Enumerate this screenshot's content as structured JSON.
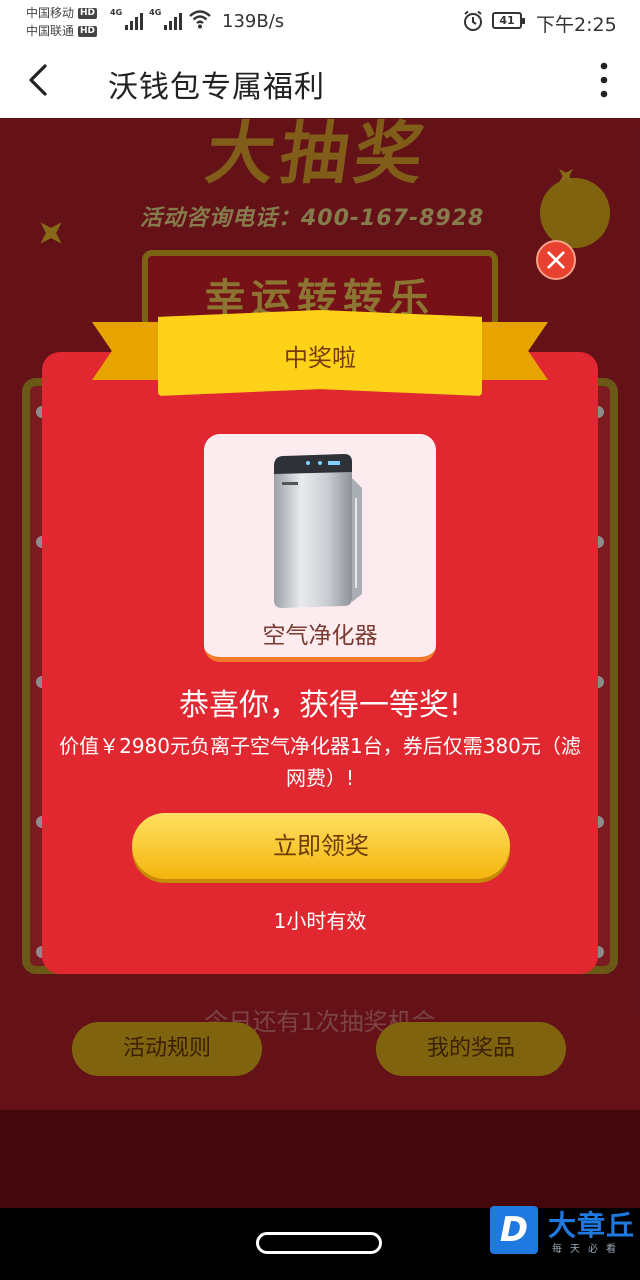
{
  "status_bar": {
    "carrier1": "中国移动",
    "carrier2": "中国联通",
    "hd": "HD",
    "network_type": "4G",
    "net_speed": "139B/s",
    "battery": "41",
    "time": "下午2:25"
  },
  "title_bar": {
    "title": "沃钱包专属福利",
    "back_icon": "chevron-left-icon",
    "more_icon": "more-vertical-icon"
  },
  "background": {
    "big_title": "大抽奖",
    "phone_line": "活动咨询电话：400-167-8928",
    "lucky_title": "幸运转转乐",
    "chances": "今日还有1次抽奖机会",
    "rules_button": "活动规则",
    "prizes_button": "我的奖品"
  },
  "modal": {
    "ribbon": "中奖啦",
    "prize_name": "空气净化器",
    "congrats": "恭喜你，获得一等奖!",
    "description": "价值￥2980元负离子空气净化器1台，券后仅需380元（滤网费）!",
    "claim_button": "立即领奖",
    "validity": "1小时有效",
    "close_icon": "close-icon"
  },
  "watermark": {
    "logo": "D",
    "title": "大章丘",
    "subtitle": "每天必看"
  },
  "colors": {
    "modal_red": "#e1272f",
    "ribbon_yellow": "#ffd21a",
    "button_gold": "#f4b50d"
  }
}
